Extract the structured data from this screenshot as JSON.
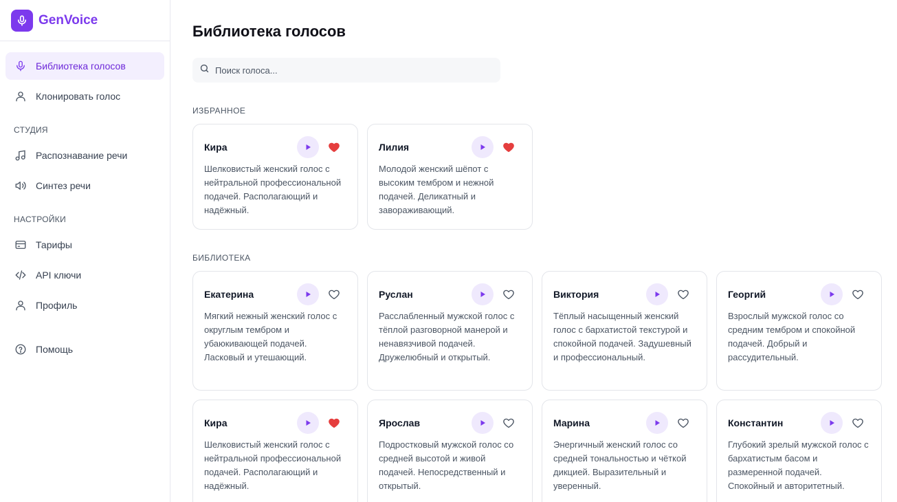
{
  "app": {
    "name": "GenVoice"
  },
  "sidebar": {
    "items": [
      {
        "label": "Библиотека голосов",
        "icon": "microphone-icon",
        "active": true
      },
      {
        "label": "Клонировать голос",
        "icon": "user-icon"
      }
    ],
    "studio": {
      "title": "СТУДИЯ",
      "items": [
        {
          "label": "Распознавание речи",
          "icon": "music-note-icon"
        },
        {
          "label": "Синтез речи",
          "icon": "speaker-icon"
        }
      ]
    },
    "settings": {
      "title": "НАСТРОЙКИ",
      "items": [
        {
          "label": "Тарифы",
          "icon": "credit-card-icon"
        },
        {
          "label": "API ключи",
          "icon": "code-icon"
        },
        {
          "label": "Профиль",
          "icon": "user-icon"
        }
      ]
    },
    "help": {
      "label": "Помощь",
      "icon": "help-circle-icon"
    }
  },
  "main": {
    "title": "Библиотека голосов",
    "search": {
      "placeholder": "Поиск голоса...",
      "value": ""
    },
    "favorites": {
      "title": "ИЗБРАННОЕ",
      "cards": [
        {
          "name": "Кира",
          "favorite": true,
          "description": "Шелковистый женский голос с нейтральной профессиональной подачей. Располагающий и надёжный."
        },
        {
          "name": "Лилия",
          "favorite": true,
          "description": "Молодой женский шёпот с высоким тембром и нежной подачей. Деликатный и завораживающий."
        }
      ]
    },
    "library": {
      "title": "БИБЛИОТЕКА",
      "cards": [
        {
          "name": "Екатерина",
          "favorite": false,
          "description": "Мягкий нежный женский голос с округлым тембром и убаюкивающей подачей. Ласковый и утешающий."
        },
        {
          "name": "Руслан",
          "favorite": false,
          "description": "Расслабленный мужской голос с тёплой разговорной манерой и ненавязчивой подачей. Дружелюбный и открытый."
        },
        {
          "name": "Виктория",
          "favorite": false,
          "description": "Тёплый насыщенный женский голос с бархатистой текстурой и спокойной подачей. Задушевный и профессиональный."
        },
        {
          "name": "Георгий",
          "favorite": false,
          "description": "Взрослый мужской голос со средним тембром и спокойной подачей. Добрый и рассудительный."
        },
        {
          "name": "Кира",
          "favorite": true,
          "description": "Шелковистый женский голос с нейтральной профессиональной подачей. Располагающий и надёжный."
        },
        {
          "name": "Ярослав",
          "favorite": false,
          "description": "Подростковый мужской голос со средней высотой и живой подачей. Непосредственный и открытый."
        },
        {
          "name": "Марина",
          "favorite": false,
          "description": "Энергичный женский голос со средней тональностью и чёткой дикцией. Выразительный и уверенный."
        },
        {
          "name": "Константин",
          "favorite": false,
          "description": "Глубокий зрелый мужской голос с бархатистым басом и размеренной подачей. Спокойный и авторитетный."
        }
      ]
    }
  },
  "colors": {
    "accent": "#7c3aed",
    "accent_soft": "#efe9fd",
    "heart": "#e53e3e",
    "active_bg": "#f3effe"
  }
}
